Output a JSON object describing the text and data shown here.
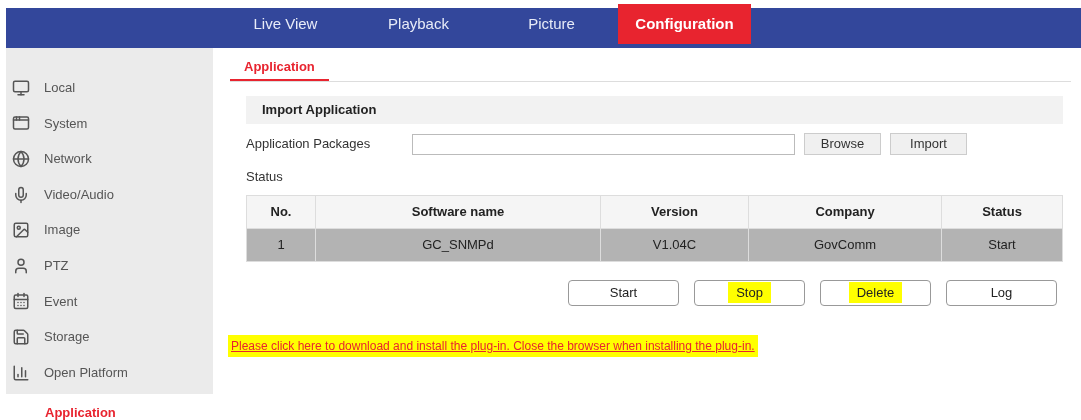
{
  "nav_tabs": [
    {
      "label": "Live View",
      "selected": false
    },
    {
      "label": "Playback",
      "selected": false
    },
    {
      "label": "Picture",
      "selected": false
    },
    {
      "label": "Configuration",
      "selected": true
    }
  ],
  "sidebar": {
    "items": [
      {
        "kind": "monitor",
        "label": "Local",
        "selected": false
      },
      {
        "kind": "window",
        "label": "System",
        "selected": false
      },
      {
        "kind": "globe",
        "label": "Network",
        "selected": false
      },
      {
        "kind": "mic",
        "label": "Video/Audio",
        "selected": false
      },
      {
        "kind": "image",
        "label": "Image",
        "selected": false
      },
      {
        "kind": "ptz",
        "label": "PTZ",
        "selected": false
      },
      {
        "kind": "calendar",
        "label": "Event",
        "selected": false
      },
      {
        "kind": "save",
        "label": "Storage",
        "selected": false
      },
      {
        "kind": "chart",
        "label": "Open Platform",
        "selected": false
      }
    ],
    "subitems": [
      {
        "label": "Application",
        "selected": true
      }
    ]
  },
  "page_tabs": [
    {
      "label": "Application",
      "selected": true
    }
  ],
  "section_title": "Import Application",
  "package_field": {
    "label": "Application Packages",
    "buttons": [
      "Browse",
      "Import"
    ]
  },
  "status_label": "Status",
  "table": {
    "columns": [
      "No.",
      "Software name",
      "Version",
      "Company",
      "Status"
    ],
    "rows": [
      {
        "selected": true,
        "cells": [
          "1",
          "GC_SNMPd",
          "V1.04C",
          "GovComm",
          "Start"
        ]
      }
    ]
  },
  "actions": [
    {
      "label": "Start",
      "highlighted": false
    },
    {
      "label": "Stop",
      "highlighted": true
    },
    {
      "label": "Delete",
      "highlighted": true
    },
    {
      "label": "Log",
      "highlighted": false
    }
  ],
  "plugin_notice": {
    "text": "Please click here to download and install the plug-in. Close the browser when installing the plug-in.",
    "highlighted": true
  }
}
